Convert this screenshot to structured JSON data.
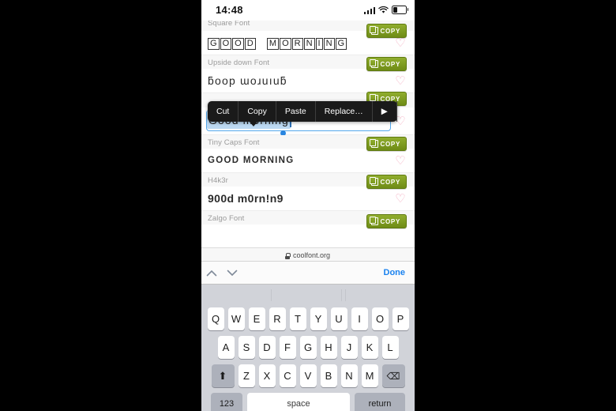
{
  "status_bar": {
    "time": "14:48",
    "signal_icon": "cellular-bars-icon",
    "wifi_icon": "wifi-icon",
    "battery_icon": "battery-low-icon"
  },
  "browser": {
    "url": "coolfont.org",
    "lock_icon": "lock-icon"
  },
  "font_rows": [
    {
      "label": "Square Font",
      "text": "GOOD MORNING",
      "style": "square",
      "copy_label": "COPY",
      "favorite_icon": "heart-outline-icon",
      "clipped": true
    },
    {
      "label": "Upside down Font",
      "text": "ƃoop ɯoɹuıuƃ",
      "style": "plain",
      "copy_label": "COPY",
      "favorite_icon": "heart-outline-icon",
      "clipped": false
    },
    {
      "label": "",
      "text": "Good morning",
      "style": "active",
      "copy_label": "COPY",
      "favorite_icon": "heart-outline-icon",
      "clipped": false
    },
    {
      "label": "Tiny Caps Font",
      "text": "GOOD MORNING",
      "style": "tiny",
      "copy_label": "COPY",
      "favorite_icon": "heart-outline-icon",
      "clipped": false
    },
    {
      "label": "H4k3r",
      "text": "900d m0rn!n9",
      "style": "hacker",
      "copy_label": "COPY",
      "favorite_icon": "heart-outline-icon",
      "clipped": false
    },
    {
      "label": "Zalgo Font",
      "text": "",
      "style": "plain",
      "copy_label": "COPY",
      "favorite_icon": "heart-outline-icon",
      "clipped": true
    }
  ],
  "square_letters": [
    "G",
    "O",
    "O",
    "D",
    "M",
    "O",
    "R",
    "N",
    "I",
    "N",
    "G"
  ],
  "selection": {
    "value": "Good morning",
    "handle_icon": "selection-handle-icon",
    "caret_icon": "text-caret-icon"
  },
  "context_menu": {
    "items": [
      {
        "label": "Cut",
        "name": "cut"
      },
      {
        "label": "Copy",
        "name": "copy"
      },
      {
        "label": "Paste",
        "name": "paste"
      },
      {
        "label": "Replace…",
        "name": "replace"
      },
      {
        "label": "▶",
        "name": "more"
      }
    ]
  },
  "accessory_bar": {
    "prev_icon": "chevron-up-icon",
    "next_icon": "chevron-down-icon",
    "done_label": "Done"
  },
  "keyboard": {
    "row1": [
      "Q",
      "W",
      "E",
      "R",
      "T",
      "Y",
      "U",
      "I",
      "O",
      "P"
    ],
    "row2": [
      "A",
      "S",
      "D",
      "F",
      "G",
      "H",
      "J",
      "K",
      "L"
    ],
    "row3": [
      "Z",
      "X",
      "C",
      "V",
      "B",
      "N",
      "M"
    ],
    "shift_icon": "shift-arrow-icon",
    "backspace_icon": "backspace-icon",
    "numbers_label": "123",
    "space_label": "space",
    "return_label": "return"
  },
  "colors": {
    "copy_green": "#7c991f",
    "heart_pink": "#f3a8bd",
    "selection_blue": "#bcd9f2",
    "focus_blue": "#54a8ec",
    "link_blue": "#1a82ef",
    "keyboard_bg": "#d1d3d9"
  }
}
